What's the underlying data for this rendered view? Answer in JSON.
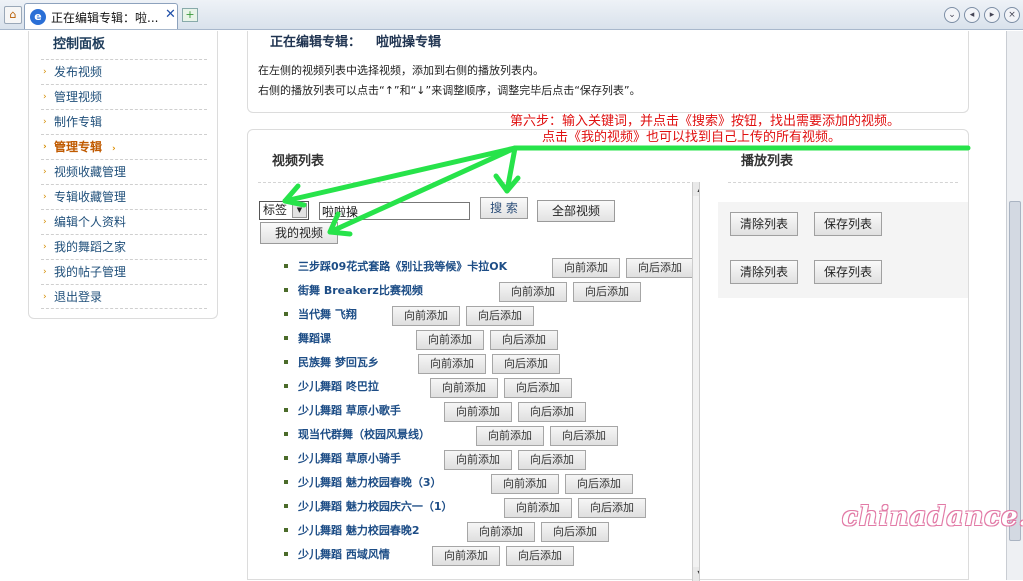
{
  "browser": {
    "tab_title": "正在编辑专辑：啦...",
    "tab_close": "✕",
    "newtab_glyph": "+",
    "icons": [
      "home-icon",
      "ie-icon",
      "close-icon",
      "new-tab-icon",
      "chevron-down-icon",
      "back-icon",
      "forward-icon",
      "close-window-icon"
    ]
  },
  "sidebar": {
    "title": "控制面板",
    "items": [
      {
        "label": "发布视频"
      },
      {
        "label": "管理视频"
      },
      {
        "label": "制作专辑"
      },
      {
        "label": "管理专辑"
      },
      {
        "label": "视频收藏管理"
      },
      {
        "label": "专辑收藏管理"
      },
      {
        "label": "编辑个人资料"
      },
      {
        "label": "我的舞蹈之家"
      },
      {
        "label": "我的帖子管理"
      },
      {
        "label": "退出登录"
      }
    ]
  },
  "header": {
    "edit_label": "正在编辑专辑：",
    "album_name": "啦啦操专辑",
    "instr1": "在左侧的视频列表中选择视频，添加到右侧的播放列表内。",
    "instr2": "右侧的播放列表可以点击“↑”和“↓”来调整顺序，调整完毕后点击“保存列表”。"
  },
  "annotation": {
    "line1": "第六步：输入关键词，并点击《搜索》按钮，找出需要添加的视频。",
    "line2": "点击《我的视频》也可以找到自己上传的所有视频。"
  },
  "video_list": {
    "title": "视频列表",
    "select_value": "标签",
    "keyword": "啦啦操",
    "search_label": "搜 索",
    "all_label": "全部视频",
    "mine_label": "我的视频",
    "forward_label": "向前添加",
    "backward_label": "向后添加",
    "items": [
      {
        "title": "三步踩09花式套路《别让我等候》卡拉OK"
      },
      {
        "title": "街舞 Breakerz比赛视频"
      },
      {
        "title": "当代舞 飞翔"
      },
      {
        "title": "舞蹈课"
      },
      {
        "title": "民族舞 梦回瓦乡"
      },
      {
        "title": "少儿舞蹈 咚巴拉"
      },
      {
        "title": "少儿舞蹈 草原小歌手"
      },
      {
        "title": "现当代群舞（校园风景线）"
      },
      {
        "title": "少儿舞蹈 草原小骑手"
      },
      {
        "title": "少儿舞蹈 魅力校园春晚（3）"
      },
      {
        "title": "少儿舞蹈 魅力校园庆六一（1）"
      },
      {
        "title": "少儿舞蹈 魅力校园春晚2"
      },
      {
        "title": "少儿舞蹈 西域风情"
      }
    ]
  },
  "playlist": {
    "title": "播放列表",
    "clear_label": "清除列表",
    "save_label": "保存列表"
  },
  "watermark": "chinadance.cn",
  "colors": {
    "annotation": "#e01010",
    "arrow": "#27e34a",
    "link": "#1d4d86",
    "accent": "#c05a00"
  }
}
